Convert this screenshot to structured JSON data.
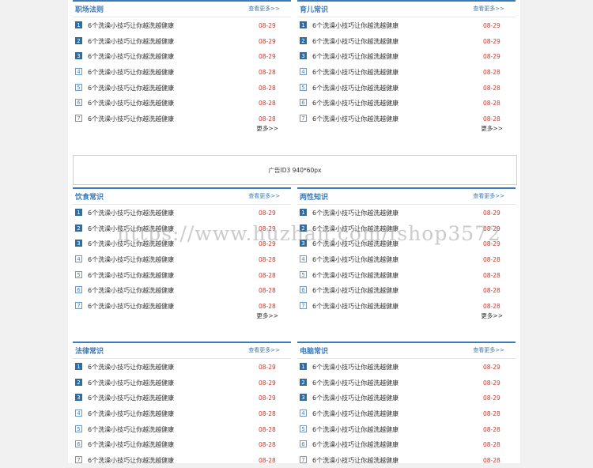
{
  "watermark": "https://www.huzhan.com/fshop3572",
  "ad": {
    "label": "广告ID3 940*60px"
  },
  "panels": [
    {
      "title": "职场法则",
      "more": "查看更多>>",
      "bottom_more": "更多>>",
      "items": [
        {
          "num": "1",
          "title": "6个洗澡小技巧让你越洗越健康",
          "date": "08-29"
        },
        {
          "num": "2",
          "title": "6个洗澡小技巧让你越洗越健康",
          "date": "08-29"
        },
        {
          "num": "3",
          "title": "6个洗澡小技巧让你越洗越健康",
          "date": "08-29"
        },
        {
          "num": "4",
          "title": "6个洗澡小技巧让你越洗越健康",
          "date": "08-28"
        },
        {
          "num": "5",
          "title": "6个洗澡小技巧让你越洗越健康",
          "date": "08-28"
        },
        {
          "num": "6",
          "title": "6个洗澡小技巧让你越洗越健康",
          "date": "08-28"
        },
        {
          "num": "7",
          "title": "6个洗澡小技巧让你越洗越健康",
          "date": "08-28"
        }
      ]
    },
    {
      "title": "育儿常识",
      "more": "查看更多>>",
      "bottom_more": "更多>>",
      "items": [
        {
          "num": "1",
          "title": "6个洗澡小技巧让你越洗越健康",
          "date": "08-29"
        },
        {
          "num": "2",
          "title": "6个洗澡小技巧让你越洗越健康",
          "date": "08-29"
        },
        {
          "num": "3",
          "title": "6个洗澡小技巧让你越洗越健康",
          "date": "08-29"
        },
        {
          "num": "4",
          "title": "6个洗澡小技巧让你越洗越健康",
          "date": "08-28"
        },
        {
          "num": "5",
          "title": "6个洗澡小技巧让你越洗越健康",
          "date": "08-28"
        },
        {
          "num": "6",
          "title": "6个洗澡小技巧让你越洗越健康",
          "date": "08-28"
        },
        {
          "num": "7",
          "title": "6个洗澡小技巧让你越洗越健康",
          "date": "08-28"
        }
      ]
    },
    {
      "title": "饮食常识",
      "more": "查看更多>>",
      "bottom_more": "更多>>",
      "items": [
        {
          "num": "1",
          "title": "6个洗澡小技巧让你越洗越健康",
          "date": "08-29"
        },
        {
          "num": "2",
          "title": "6个洗澡小技巧让你越洗越健康",
          "date": "08-29"
        },
        {
          "num": "3",
          "title": "6个洗澡小技巧让你越洗越健康",
          "date": "08-29"
        },
        {
          "num": "4",
          "title": "6个洗澡小技巧让你越洗越健康",
          "date": "08-28"
        },
        {
          "num": "5",
          "title": "6个洗澡小技巧让你越洗越健康",
          "date": "08-28"
        },
        {
          "num": "6",
          "title": "6个洗澡小技巧让你越洗越健康",
          "date": "08-28"
        },
        {
          "num": "7",
          "title": "6个洗澡小技巧让你越洗越健康",
          "date": "08-28"
        }
      ]
    },
    {
      "title": "两性知识",
      "more": "查看更多>>",
      "bottom_more": "更多>>",
      "items": [
        {
          "num": "1",
          "title": "6个洗澡小技巧让你越洗越健康",
          "date": "08-29"
        },
        {
          "num": "2",
          "title": "6个洗澡小技巧让你越洗越健康",
          "date": "08-29"
        },
        {
          "num": "3",
          "title": "6个洗澡小技巧让你越洗越健康",
          "date": "08-29"
        },
        {
          "num": "4",
          "title": "6个洗澡小技巧让你越洗越健康",
          "date": "08-28"
        },
        {
          "num": "5",
          "title": "6个洗澡小技巧让你越洗越健康",
          "date": "08-28"
        },
        {
          "num": "6",
          "title": "6个洗澡小技巧让你越洗越健康",
          "date": "08-28"
        },
        {
          "num": "7",
          "title": "6个洗澡小技巧让你越洗越健康",
          "date": "08-28"
        }
      ]
    },
    {
      "title": "法律常识",
      "more": "查看更多>>",
      "bottom_more": "",
      "items": [
        {
          "num": "1",
          "title": "6个洗澡小技巧让你越洗越健康",
          "date": "08-29"
        },
        {
          "num": "2",
          "title": "6个洗澡小技巧让你越洗越健康",
          "date": "08-29"
        },
        {
          "num": "3",
          "title": "6个洗澡小技巧让你越洗越健康",
          "date": "08-29"
        },
        {
          "num": "4",
          "title": "6个洗澡小技巧让你越洗越健康",
          "date": "08-28"
        },
        {
          "num": "5",
          "title": "6个洗澡小技巧让你越洗越健康",
          "date": "08-28"
        },
        {
          "num": "6",
          "title": "6个洗澡小技巧让你越洗越健康",
          "date": "08-28"
        },
        {
          "num": "7",
          "title": "6个洗澡小技巧让你越洗越健康",
          "date": "08-28"
        }
      ]
    },
    {
      "title": "电脑常识",
      "more": "查看更多>>",
      "bottom_more": "",
      "items": [
        {
          "num": "1",
          "title": "6个洗澡小技巧让你越洗越健康",
          "date": "08-29"
        },
        {
          "num": "2",
          "title": "6个洗澡小技巧让你越洗越健康",
          "date": "08-29"
        },
        {
          "num": "3",
          "title": "6个洗澡小技巧让你越洗越健康",
          "date": "08-29"
        },
        {
          "num": "4",
          "title": "6个洗澡小技巧让你越洗越健康",
          "date": "08-28"
        },
        {
          "num": "5",
          "title": "6个洗澡小技巧让你越洗越健康",
          "date": "08-28"
        },
        {
          "num": "6",
          "title": "6个洗澡小技巧让你越洗越健康",
          "date": "08-28"
        },
        {
          "num": "7",
          "title": "6个洗澡小技巧让你越洗越健康",
          "date": "08-28"
        }
      ]
    }
  ]
}
